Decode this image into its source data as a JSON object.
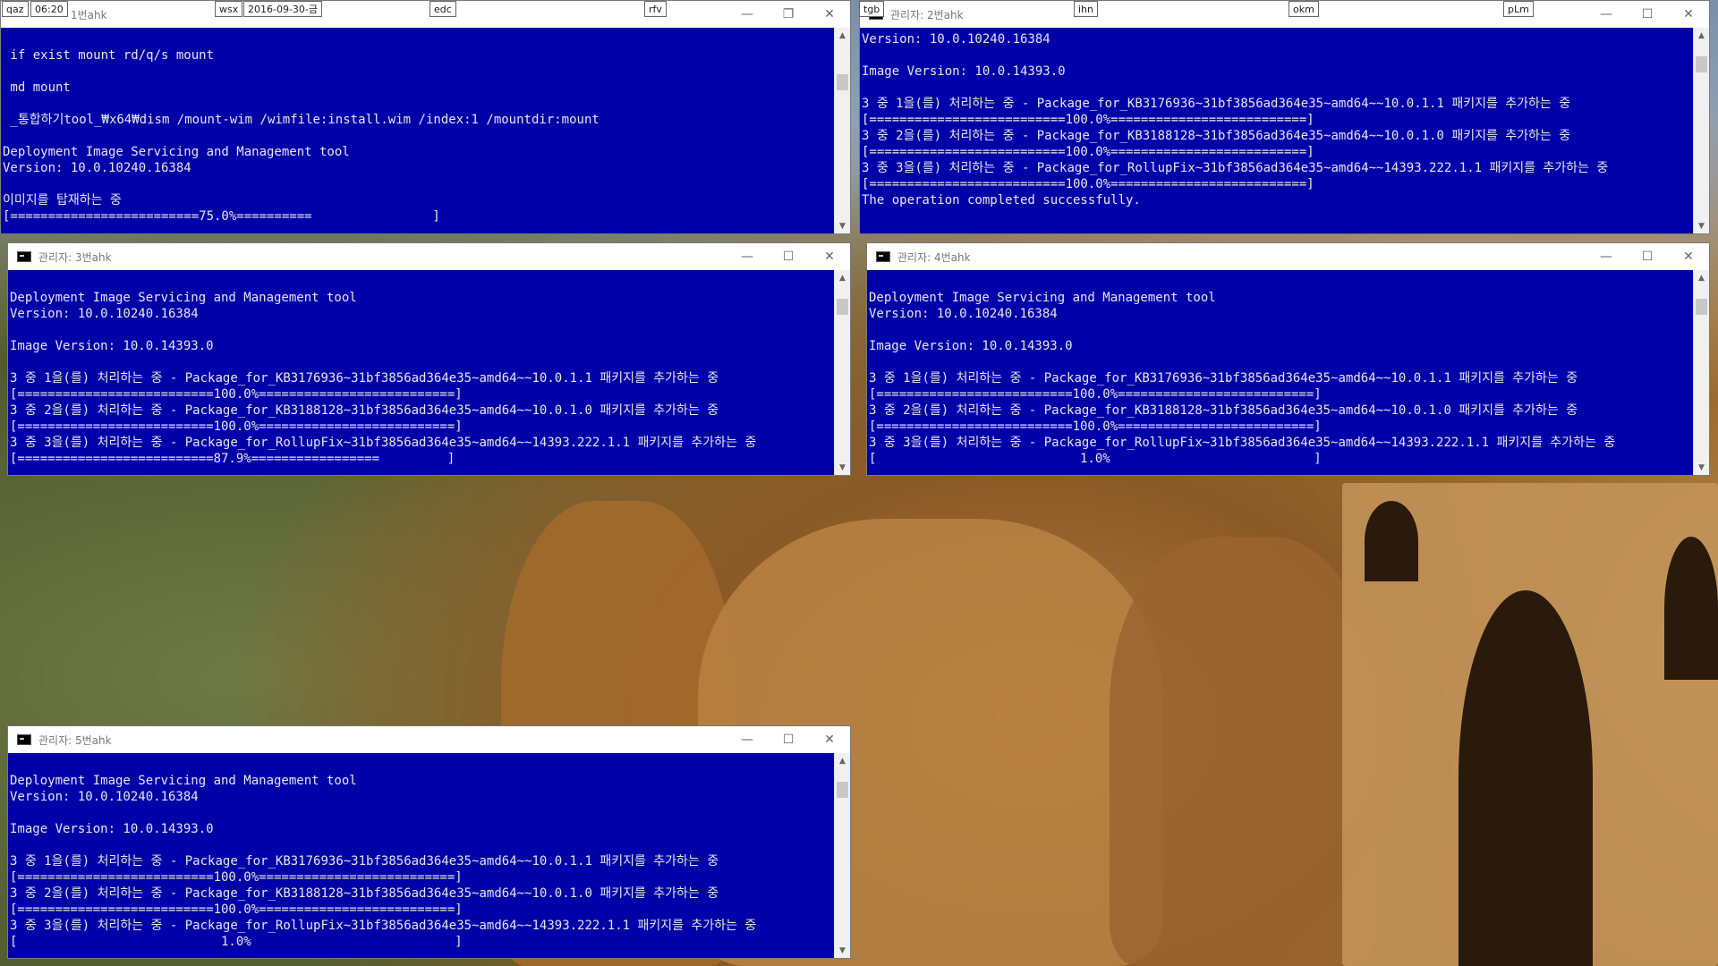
{
  "hotkeys": {
    "qaz": "qaz",
    "time": "06:20",
    "wsx": "wsx",
    "date": "2016-09-30-금",
    "edc": "edc",
    "rfv": "rfv",
    "tgb": "tgb",
    "ihn": "ihn",
    "okm": "okm",
    "plm": "pLm"
  },
  "controls": {
    "minimize": "—",
    "maximize": "☐",
    "restore": "❐",
    "close": "✕",
    "up": "▲",
    "down": "▼"
  },
  "windows": [
    {
      "title": "1번ahk",
      "lines": [
        "",
        " if exist mount rd/q/s mount",
        "",
        " md mount",
        "",
        " _통합하기tool_₩x64₩dism /mount-wim /wimfile:install.wim /index:1 /mountdir:mount",
        "",
        "Deployment Image Servicing and Management tool",
        "Version: 10.0.10240.16384",
        "",
        "이미지를 탑재하는 중",
        "[=========================75.0%==========                ]"
      ]
    },
    {
      "title": "관리자:  2번ahk",
      "lines": [
        "Version: 10.0.10240.16384",
        "",
        "Image Version: 10.0.14393.0",
        "",
        "3 중 1을(를) 처리하는 중 - Package_for_KB3176936~31bf3856ad364e35~amd64~~10.0.1.1 패키지를 추가하는 중",
        "[==========================100.0%==========================]",
        "3 중 2을(를) 처리하는 중 - Package_for_KB3188128~31bf3856ad364e35~amd64~~10.0.1.0 패키지를 추가하는 중",
        "[==========================100.0%==========================]",
        "3 중 3을(를) 처리하는 중 - Package_for_RollupFix~31bf3856ad364e35~amd64~~14393.222.1.1 패키지를 추가하는 중",
        "[==========================100.0%==========================]",
        "The operation completed successfully."
      ]
    },
    {
      "title": "관리자:  3번ahk",
      "lines": [
        "",
        "Deployment Image Servicing and Management tool",
        "Version: 10.0.10240.16384",
        "",
        "Image Version: 10.0.14393.0",
        "",
        "3 중 1을(를) 처리하는 중 - Package_for_KB3176936~31bf3856ad364e35~amd64~~10.0.1.1 패키지를 추가하는 중",
        "[==========================100.0%==========================]",
        "3 중 2을(를) 처리하는 중 - Package_for_KB3188128~31bf3856ad364e35~amd64~~10.0.1.0 패키지를 추가하는 중",
        "[==========================100.0%==========================]",
        "3 중 3을(를) 처리하는 중 - Package_for_RollupFix~31bf3856ad364e35~amd64~~14393.222.1.1 패키지를 추가하는 중",
        "[==========================87.9%=================         ]"
      ]
    },
    {
      "title": "관리자:  4번ahk",
      "lines": [
        "",
        "Deployment Image Servicing and Management tool",
        "Version: 10.0.10240.16384",
        "",
        "Image Version: 10.0.14393.0",
        "",
        "3 중 1을(를) 처리하는 중 - Package_for_KB3176936~31bf3856ad364e35~amd64~~10.0.1.1 패키지를 추가하는 중",
        "[==========================100.0%==========================]",
        "3 중 2을(를) 처리하는 중 - Package_for_KB3188128~31bf3856ad364e35~amd64~~10.0.1.0 패키지를 추가하는 중",
        "[==========================100.0%==========================]",
        "3 중 3을(를) 처리하는 중 - Package_for_RollupFix~31bf3856ad364e35~amd64~~14393.222.1.1 패키지를 추가하는 중",
        "[                           1.0%                           ]"
      ]
    },
    {
      "title": "관리자:  5번ahk",
      "lines": [
        "",
        "Deployment Image Servicing and Management tool",
        "Version: 10.0.10240.16384",
        "",
        "Image Version: 10.0.14393.0",
        "",
        "3 중 1을(를) 처리하는 중 - Package_for_KB3176936~31bf3856ad364e35~amd64~~10.0.1.1 패키지를 추가하는 중",
        "[==========================100.0%==========================]",
        "3 중 2을(를) 처리하는 중 - Package_for_KB3188128~31bf3856ad364e35~amd64~~10.0.1.0 패키지를 추가하는 중",
        "[==========================100.0%==========================]",
        "3 중 3을(를) 처리하는 중 - Package_for_RollupFix~31bf3856ad364e35~amd64~~14393.222.1.1 패키지를 추가하는 중",
        "[                           1.0%                           ]"
      ]
    }
  ]
}
